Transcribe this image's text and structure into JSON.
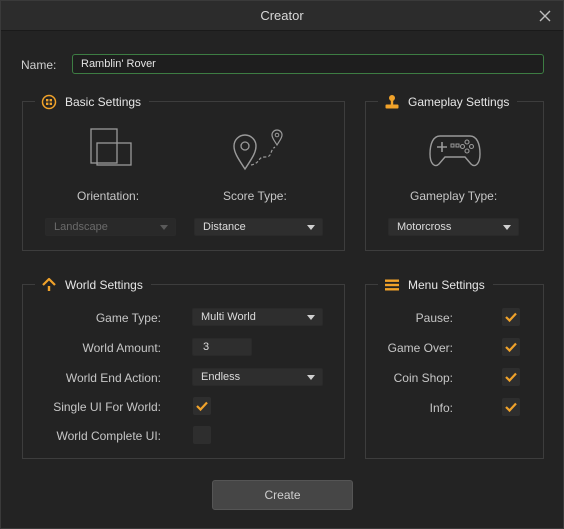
{
  "window": {
    "title": "Creator"
  },
  "name": {
    "label": "Name:",
    "value": "Ramblin' Rover"
  },
  "basic": {
    "title": "Basic Settings",
    "orientation_label": "Orientation:",
    "orientation_value": "Landscape",
    "score_type_label": "Score Type:",
    "score_type_value": "Distance"
  },
  "gameplay": {
    "title": "Gameplay Settings",
    "type_label": "Gameplay Type:",
    "type_value": "Motorcross"
  },
  "world": {
    "title": "World Settings",
    "game_type_label": "Game Type:",
    "game_type_value": "Multi World",
    "world_amount_label": "World Amount:",
    "world_amount_value": "3",
    "end_action_label": "World End Action:",
    "end_action_value": "Endless",
    "single_ui_label": "Single UI For World:",
    "single_ui_checked": true,
    "complete_ui_label": "World Complete UI:",
    "complete_ui_checked": false
  },
  "menu": {
    "title": "Menu Settings",
    "items": [
      {
        "label": "Pause:",
        "checked": true
      },
      {
        "label": "Game Over:",
        "checked": true
      },
      {
        "label": "Coin Shop:",
        "checked": true
      },
      {
        "label": "Info:",
        "checked": true
      }
    ]
  },
  "create_label": "Create",
  "colors": {
    "accent": "#f0a22a",
    "name_border": "#3d7d43"
  },
  "icons": [
    "close-icon",
    "basic-settings-icon",
    "gameplay-settings-icon",
    "world-settings-icon",
    "menu-settings-icon",
    "orientation-icon",
    "score-type-icon",
    "gamepad-icon",
    "checkmark-icon",
    "dropdown-arrow-icon"
  ]
}
